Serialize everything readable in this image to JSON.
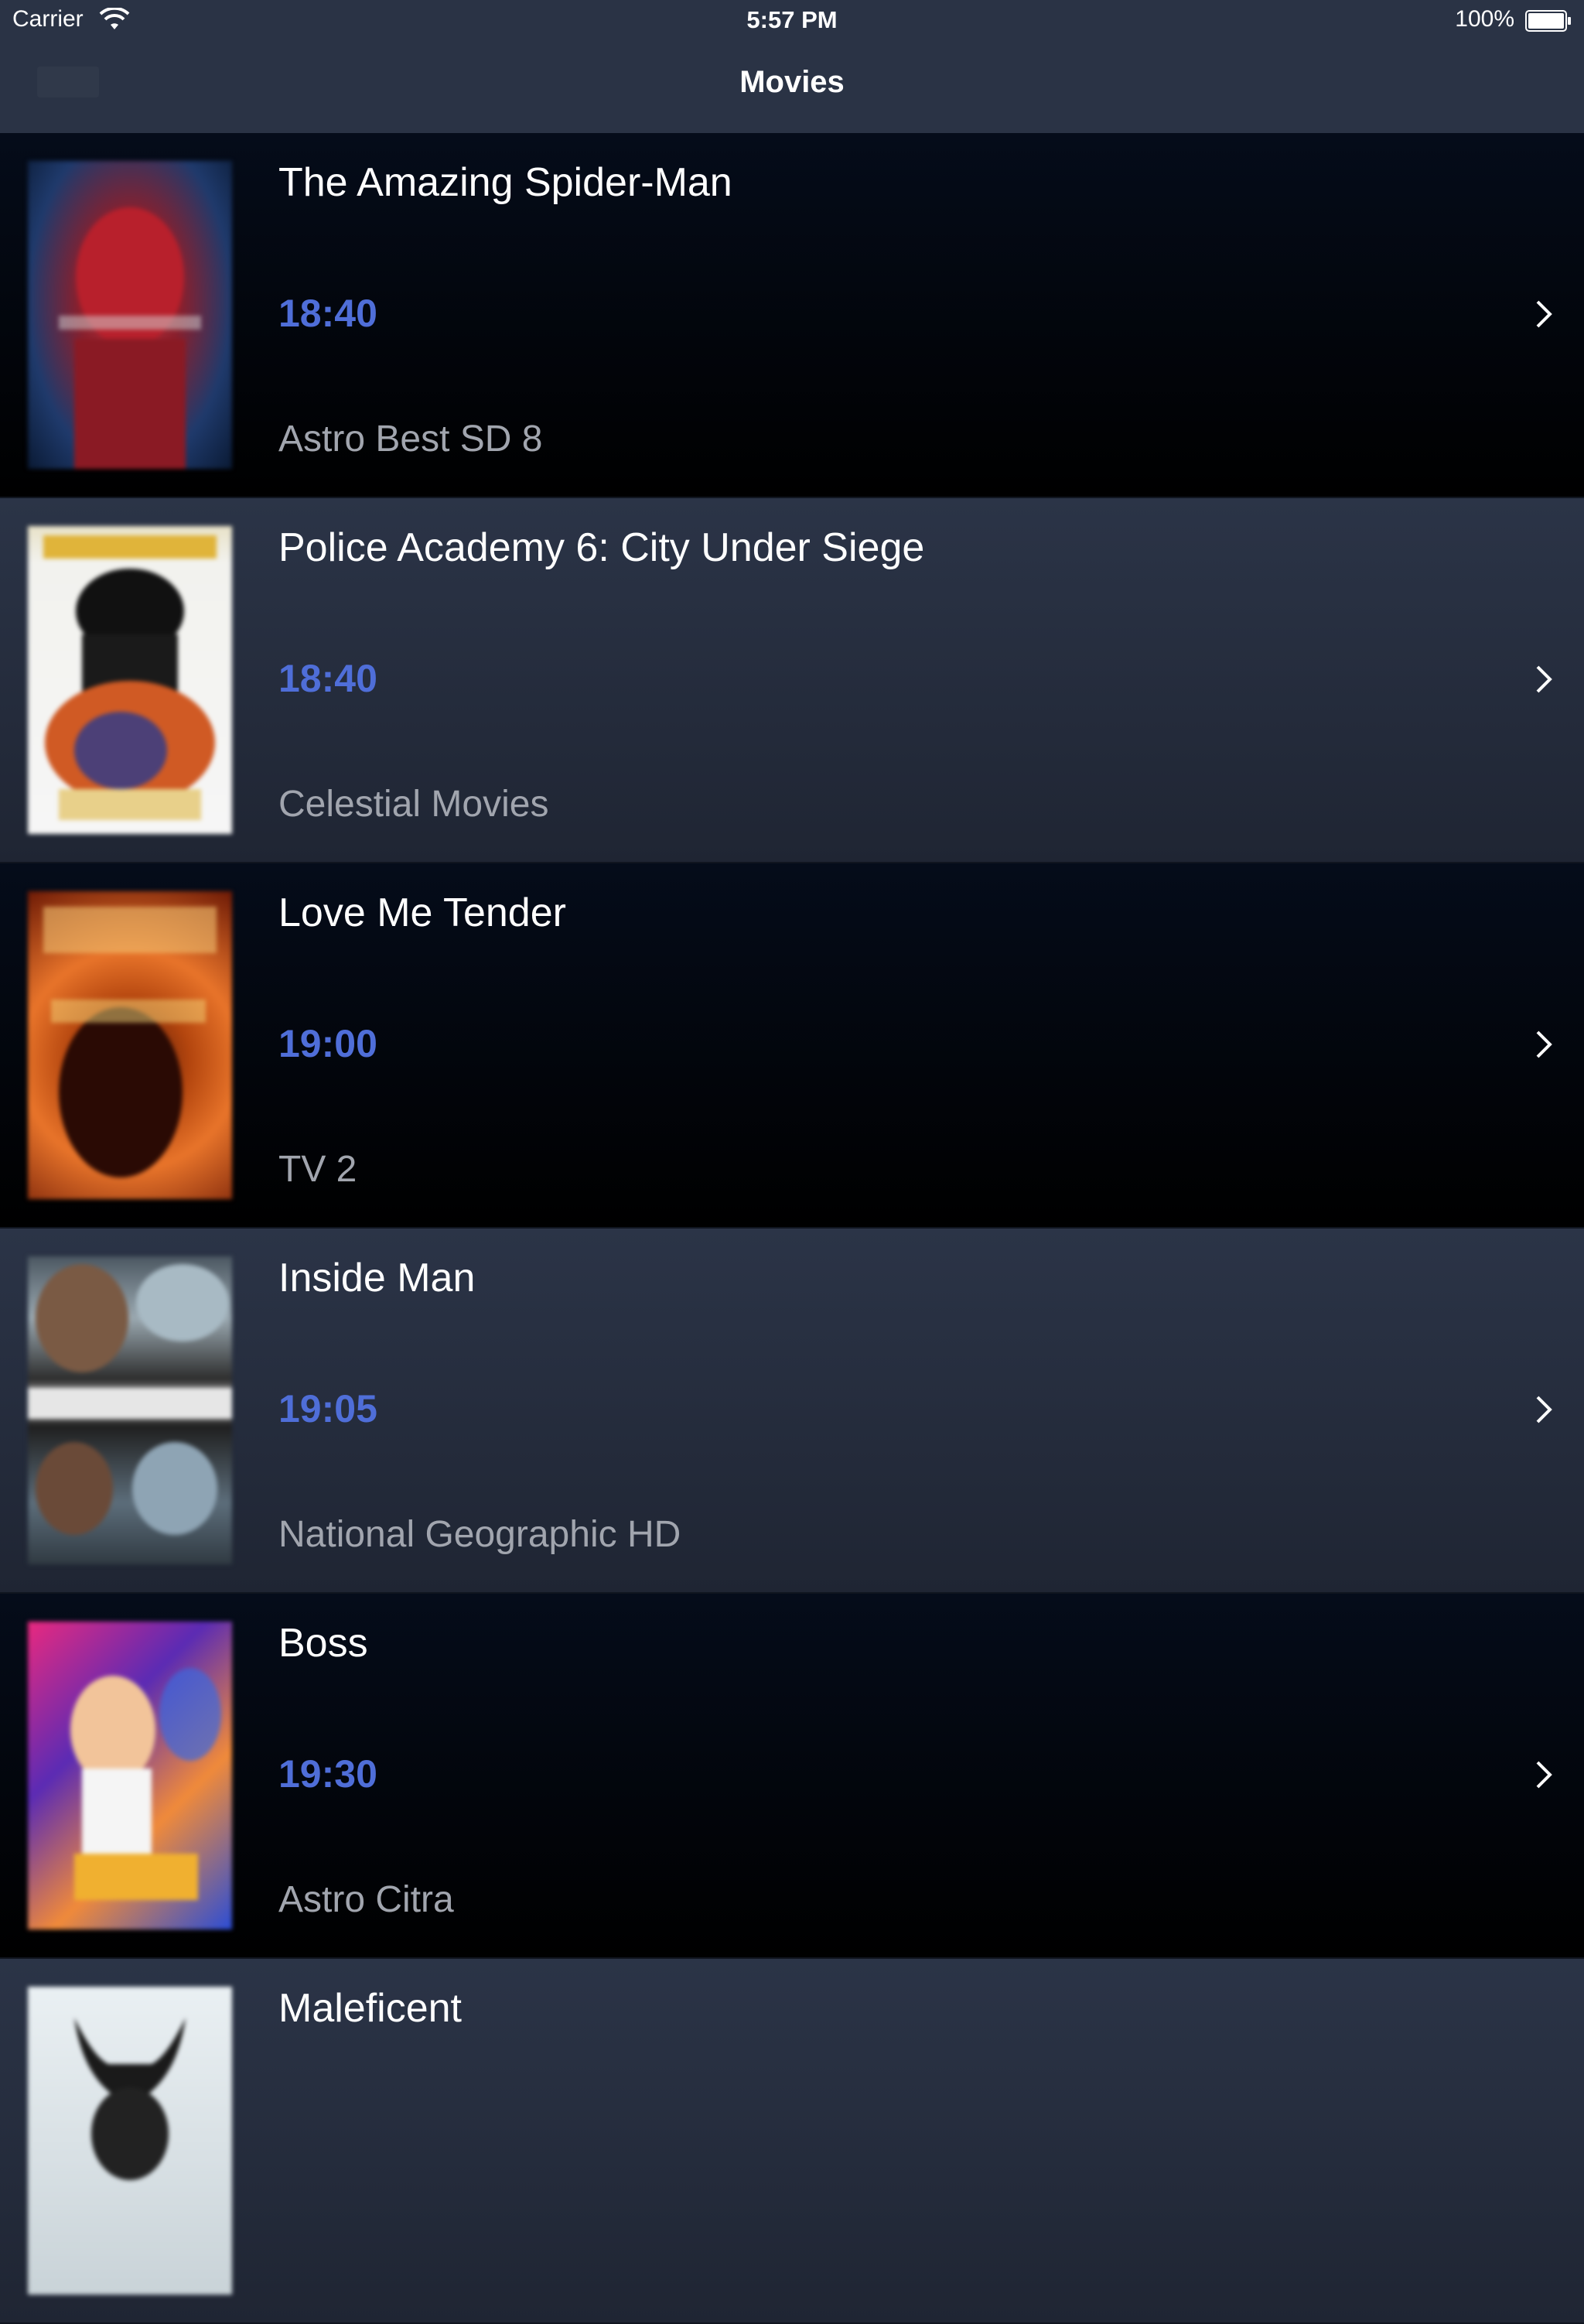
{
  "status_bar": {
    "carrier": "Carrier",
    "time": "5:57 PM",
    "battery_percent": "100%",
    "battery_level": 1.0
  },
  "nav": {
    "title": "Movies"
  },
  "movies": [
    {
      "title": "The Amazing Spider-Man",
      "time": "18:40",
      "channel": "Astro Best SD 8",
      "poster_icon": "spider-man-poster"
    },
    {
      "title": "Police Academy 6: City Under Siege",
      "time": "18:40",
      "channel": "Celestial Movies",
      "poster_icon": "police-academy-poster"
    },
    {
      "title": "Love Me Tender",
      "time": "19:00",
      "channel": "TV 2",
      "poster_icon": "love-me-tender-poster"
    },
    {
      "title": "Inside Man",
      "time": "19:05",
      "channel": "National Geographic HD",
      "poster_icon": "inside-man-poster"
    },
    {
      "title": "Boss",
      "time": "19:30",
      "channel": "Astro Citra",
      "poster_icon": "boss-poster"
    },
    {
      "title": "Maleficent",
      "time": "",
      "channel": "",
      "poster_icon": "maleficent-poster"
    }
  ],
  "colors": {
    "accent_time": "#4f6ed8",
    "nav_background": "#2a3345",
    "channel_text": "#a1a5ae"
  }
}
